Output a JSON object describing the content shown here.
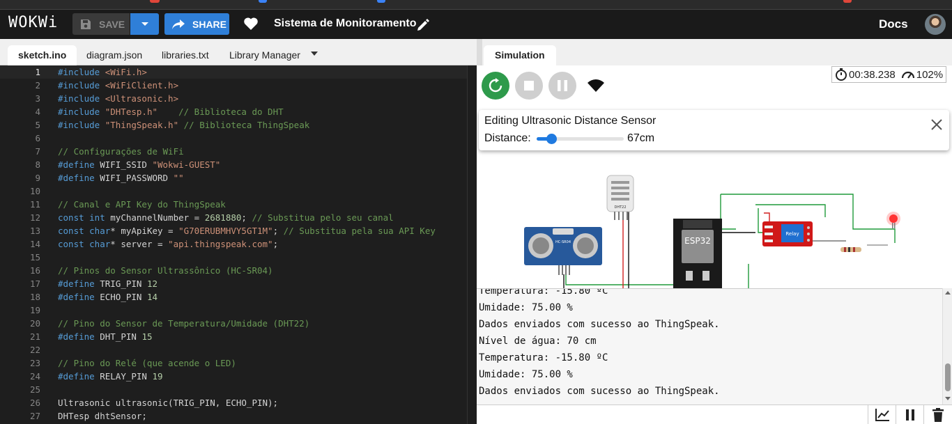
{
  "header": {
    "logo": "WOKWi",
    "save_label": "SAVE",
    "share_label": "SHARE",
    "project_title": "Sistema de Monitoramento",
    "docs_label": "Docs"
  },
  "editor_tabs": [
    "sketch.ino",
    "diagram.json",
    "libraries.txt",
    "Library Manager"
  ],
  "code": {
    "current_line": 1,
    "lines": [
      [
        [
          "pp",
          "#include "
        ],
        [
          "str",
          "<WiFi.h>"
        ]
      ],
      [
        [
          "pp",
          "#include "
        ],
        [
          "str",
          "<WiFiClient.h>"
        ]
      ],
      [
        [
          "pp",
          "#include "
        ],
        [
          "str",
          "<Ultrasonic.h>"
        ]
      ],
      [
        [
          "pp",
          "#include "
        ],
        [
          "str",
          "\"DHTesp.h\""
        ],
        [
          "id",
          "    "
        ],
        [
          "cm",
          "// Biblioteca do DHT"
        ]
      ],
      [
        [
          "pp",
          "#include "
        ],
        [
          "str",
          "\"ThingSpeak.h\""
        ],
        [
          "id",
          " "
        ],
        [
          "cm",
          "// Biblioteca ThingSpeak"
        ]
      ],
      [],
      [
        [
          "cm",
          "// Configurações de WiFi"
        ]
      ],
      [
        [
          "pp",
          "#define "
        ],
        [
          "id",
          "WIFI_SSID "
        ],
        [
          "str",
          "\"Wokwi-GUEST\""
        ]
      ],
      [
        [
          "pp",
          "#define "
        ],
        [
          "id",
          "WIFI_PASSWORD "
        ],
        [
          "str",
          "\"\""
        ]
      ],
      [],
      [
        [
          "cm",
          "// Canal e API Key do ThingSpeak"
        ]
      ],
      [
        [
          "kw",
          "const "
        ],
        [
          "kw",
          "int "
        ],
        [
          "id",
          "myChannelNumber = "
        ],
        [
          "num",
          "2681880"
        ],
        [
          "id",
          "; "
        ],
        [
          "cm",
          "// Substitua pelo seu canal"
        ]
      ],
      [
        [
          "kw",
          "const "
        ],
        [
          "kw",
          "char"
        ],
        [
          "id",
          "* myApiKey = "
        ],
        [
          "str",
          "\"G70ERUBMHVY5GT1M\""
        ],
        [
          "id",
          "; "
        ],
        [
          "cm",
          "// Substitua pela sua API Key"
        ]
      ],
      [
        [
          "kw",
          "const "
        ],
        [
          "kw",
          "char"
        ],
        [
          "id",
          "* server = "
        ],
        [
          "str",
          "\"api.thingspeak.com\""
        ],
        [
          "id",
          ";"
        ]
      ],
      [],
      [
        [
          "cm",
          "// Pinos do Sensor Ultrassônico (HC-SR04)"
        ]
      ],
      [
        [
          "pp",
          "#define "
        ],
        [
          "id",
          "TRIG_PIN "
        ],
        [
          "num",
          "12"
        ]
      ],
      [
        [
          "pp",
          "#define "
        ],
        [
          "id",
          "ECHO_PIN "
        ],
        [
          "num",
          "14"
        ]
      ],
      [],
      [
        [
          "cm",
          "// Pino do Sensor de Temperatura/Umidade (DHT22)"
        ]
      ],
      [
        [
          "pp",
          "#define "
        ],
        [
          "id",
          "DHT_PIN "
        ],
        [
          "num",
          "15"
        ]
      ],
      [],
      [
        [
          "cm",
          "// Pino do Relé (que acende o LED)"
        ]
      ],
      [
        [
          "pp",
          "#define "
        ],
        [
          "id",
          "RELAY_PIN "
        ],
        [
          "num",
          "19"
        ]
      ],
      [],
      [
        [
          "id",
          "Ultrasonic ultrasonic(TRIG_PIN, ECHO_PIN);"
        ]
      ],
      [
        [
          "id",
          "DHTesp dhtSensor;"
        ]
      ]
    ]
  },
  "simulation": {
    "tab_label": "Simulation",
    "timer": "00:38.238",
    "speed": "102%",
    "editor_popup": {
      "title": "Editing Ultrasonic Distance Sensor",
      "distance_label": "Distance:",
      "distance_value": "67cm",
      "slider_fraction": 0.17
    },
    "components": {
      "ultrasonic_label": "HC-SR04",
      "dht_label": "DHT22",
      "esp_label": "ESP32",
      "relay_label": "Relay"
    }
  },
  "serial_monitor": {
    "lines": [
      "Temperatura: -15.80 ºC",
      "Umidade: 75.00 %",
      "Dados enviados com sucesso ao ThingSpeak.",
      "Nível de água: 70 cm",
      "Temperatura: -15.80 ºC",
      "Umidade: 75.00 %",
      "Dados enviados com sucesso ao ThingSpeak."
    ]
  },
  "colors": {
    "accent_blue": "#2f7fd8",
    "run_green": "#2e9a4b",
    "editor_bg": "#1e1e1e",
    "wire_green": "#1f9a3a",
    "wire_red": "#d11f1f"
  }
}
